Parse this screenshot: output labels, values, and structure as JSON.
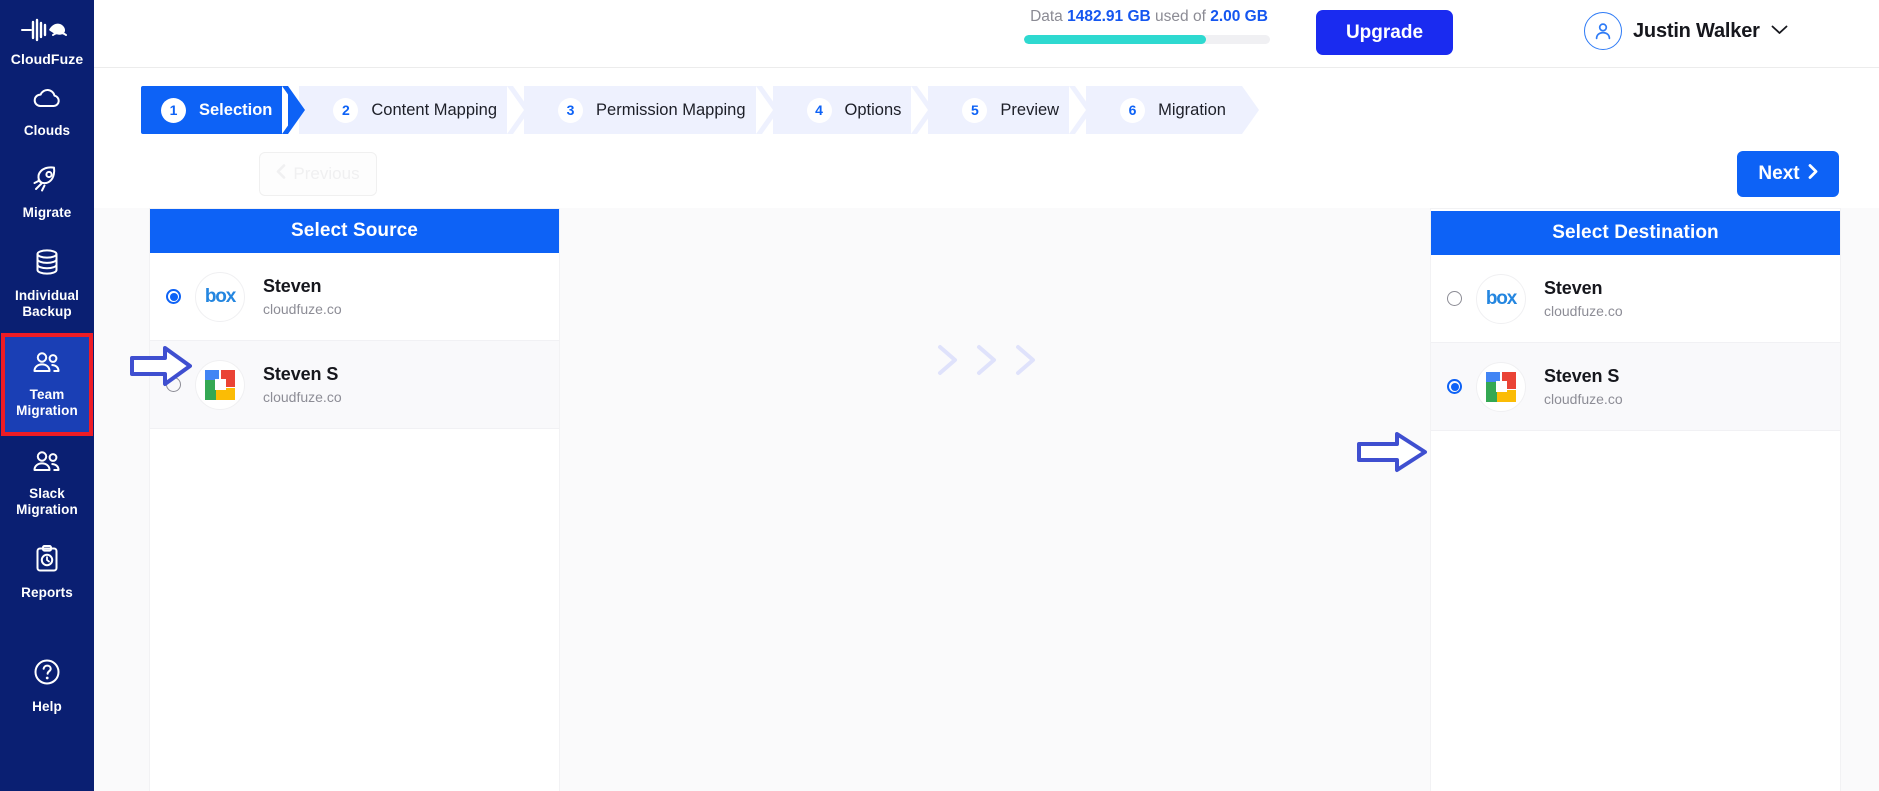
{
  "sidebar": {
    "brand": {
      "name": "CloudFuze",
      "icon": "cloudfuze-logo-icon"
    },
    "items": [
      {
        "label": "Clouds",
        "icon": "cloud-icon",
        "active": false
      },
      {
        "label": "Migrate",
        "icon": "rocket-icon",
        "active": false
      },
      {
        "label": "Individual Backup",
        "icon": "database-icon",
        "active": false
      },
      {
        "label": "Team Migration",
        "icon": "users-icon",
        "active": true
      },
      {
        "label": "Slack Migration",
        "icon": "users-icon",
        "active": false
      },
      {
        "label": "Reports",
        "icon": "clipboard-clock-icon",
        "active": false
      },
      {
        "label": "Help",
        "icon": "question-circle-icon",
        "active": false
      }
    ],
    "active_highlight_color": "#ee1c25",
    "background_color": "#0a1f72"
  },
  "header": {
    "data_usage": {
      "prefix": "Data",
      "used": "1482.91 GB",
      "middle": "used of",
      "total": "2.00 GB",
      "progress_percent": 74,
      "bar_color": "#2ed9d0"
    },
    "upgrade_label": "Upgrade",
    "upgrade_color": "#1a2bf0",
    "user": {
      "name": "Justin Walker",
      "avatar_icon": "user-circle-icon",
      "caret_icon": "chevron-down-icon"
    }
  },
  "stepper": {
    "steps": [
      {
        "num": "1",
        "label": "Selection",
        "active": true
      },
      {
        "num": "2",
        "label": "Content Mapping",
        "active": false
      },
      {
        "num": "3",
        "label": "Permission Mapping",
        "active": false
      },
      {
        "num": "4",
        "label": "Options",
        "active": false
      },
      {
        "num": "5",
        "label": "Preview",
        "active": false
      },
      {
        "num": "6",
        "label": "Migration",
        "active": false
      }
    ],
    "active_color": "#0d62f6",
    "inactive_color": "#eef1fe"
  },
  "nav": {
    "previous_label": "Previous",
    "previous_icon": "chevron-left-icon",
    "previous_disabled": true,
    "next_label": "Next",
    "next_icon": "chevron-right-icon"
  },
  "source_panel": {
    "title": "Select Source",
    "accounts": [
      {
        "name": "Steven",
        "domain": "cloudfuze.co",
        "provider": "box",
        "selected": true
      },
      {
        "name": "Steven S",
        "domain": "cloudfuze.co",
        "provider": "google-drive",
        "selected": false
      }
    ]
  },
  "destination_panel": {
    "title": "Select Destination",
    "accounts": [
      {
        "name": "Steven",
        "domain": "cloudfuze.co",
        "provider": "box",
        "selected": false
      },
      {
        "name": "Steven S",
        "domain": "cloudfuze.co",
        "provider": "google-drive",
        "selected": true
      }
    ]
  },
  "center": {
    "chevrons": 3,
    "chevron_color": "#dfe2fb"
  },
  "annotations": {
    "source_arrow": {
      "icon": "annotation-arrow-right",
      "color": "#3f4fd0"
    },
    "destination_arrow": {
      "icon": "annotation-arrow-right",
      "color": "#3f4fd0"
    }
  }
}
